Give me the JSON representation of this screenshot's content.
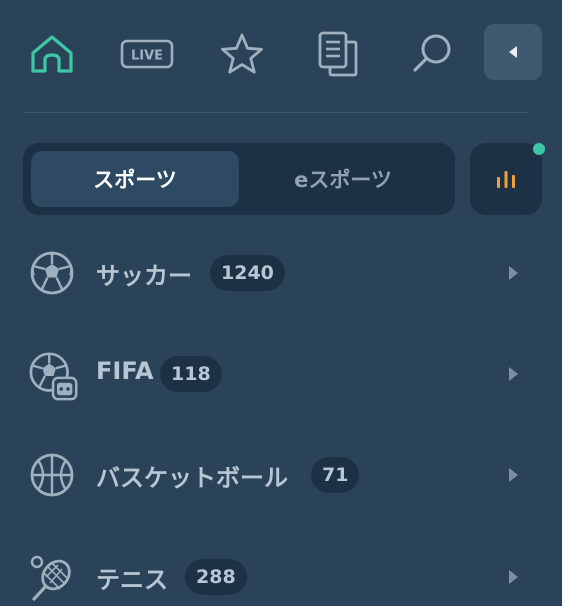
{
  "topnav": {
    "items": [
      {
        "icon": "home-icon",
        "active": true
      },
      {
        "icon": "live-icon",
        "label": "LIVE"
      },
      {
        "icon": "star-icon"
      },
      {
        "icon": "documents-icon"
      },
      {
        "icon": "search-icon"
      }
    ],
    "collapse_icon": "collapse-left-icon"
  },
  "tabs": {
    "sports": "スポーツ",
    "esports": "eスポーツ",
    "active": "sports"
  },
  "stats_button": {
    "icon": "bar-chart-icon",
    "has_notification": true
  },
  "sports": [
    {
      "name": "サッカー",
      "count": "1240",
      "icon": "soccer-ball-icon"
    },
    {
      "name": "FIFA",
      "count": "118",
      "icon": "fifa-esport-icon"
    },
    {
      "name": "バスケットボール",
      "count": "71",
      "icon": "basketball-icon"
    },
    {
      "name": "テニス",
      "count": "288",
      "icon": "tennis-icon"
    }
  ],
  "colors": {
    "background": "#2a4358",
    "panel": "#1c3144",
    "active_tab": "#2e4a63",
    "accent": "#3fc6a4",
    "stats_accent": "#f0a03c",
    "text": "#b8c6d3"
  }
}
